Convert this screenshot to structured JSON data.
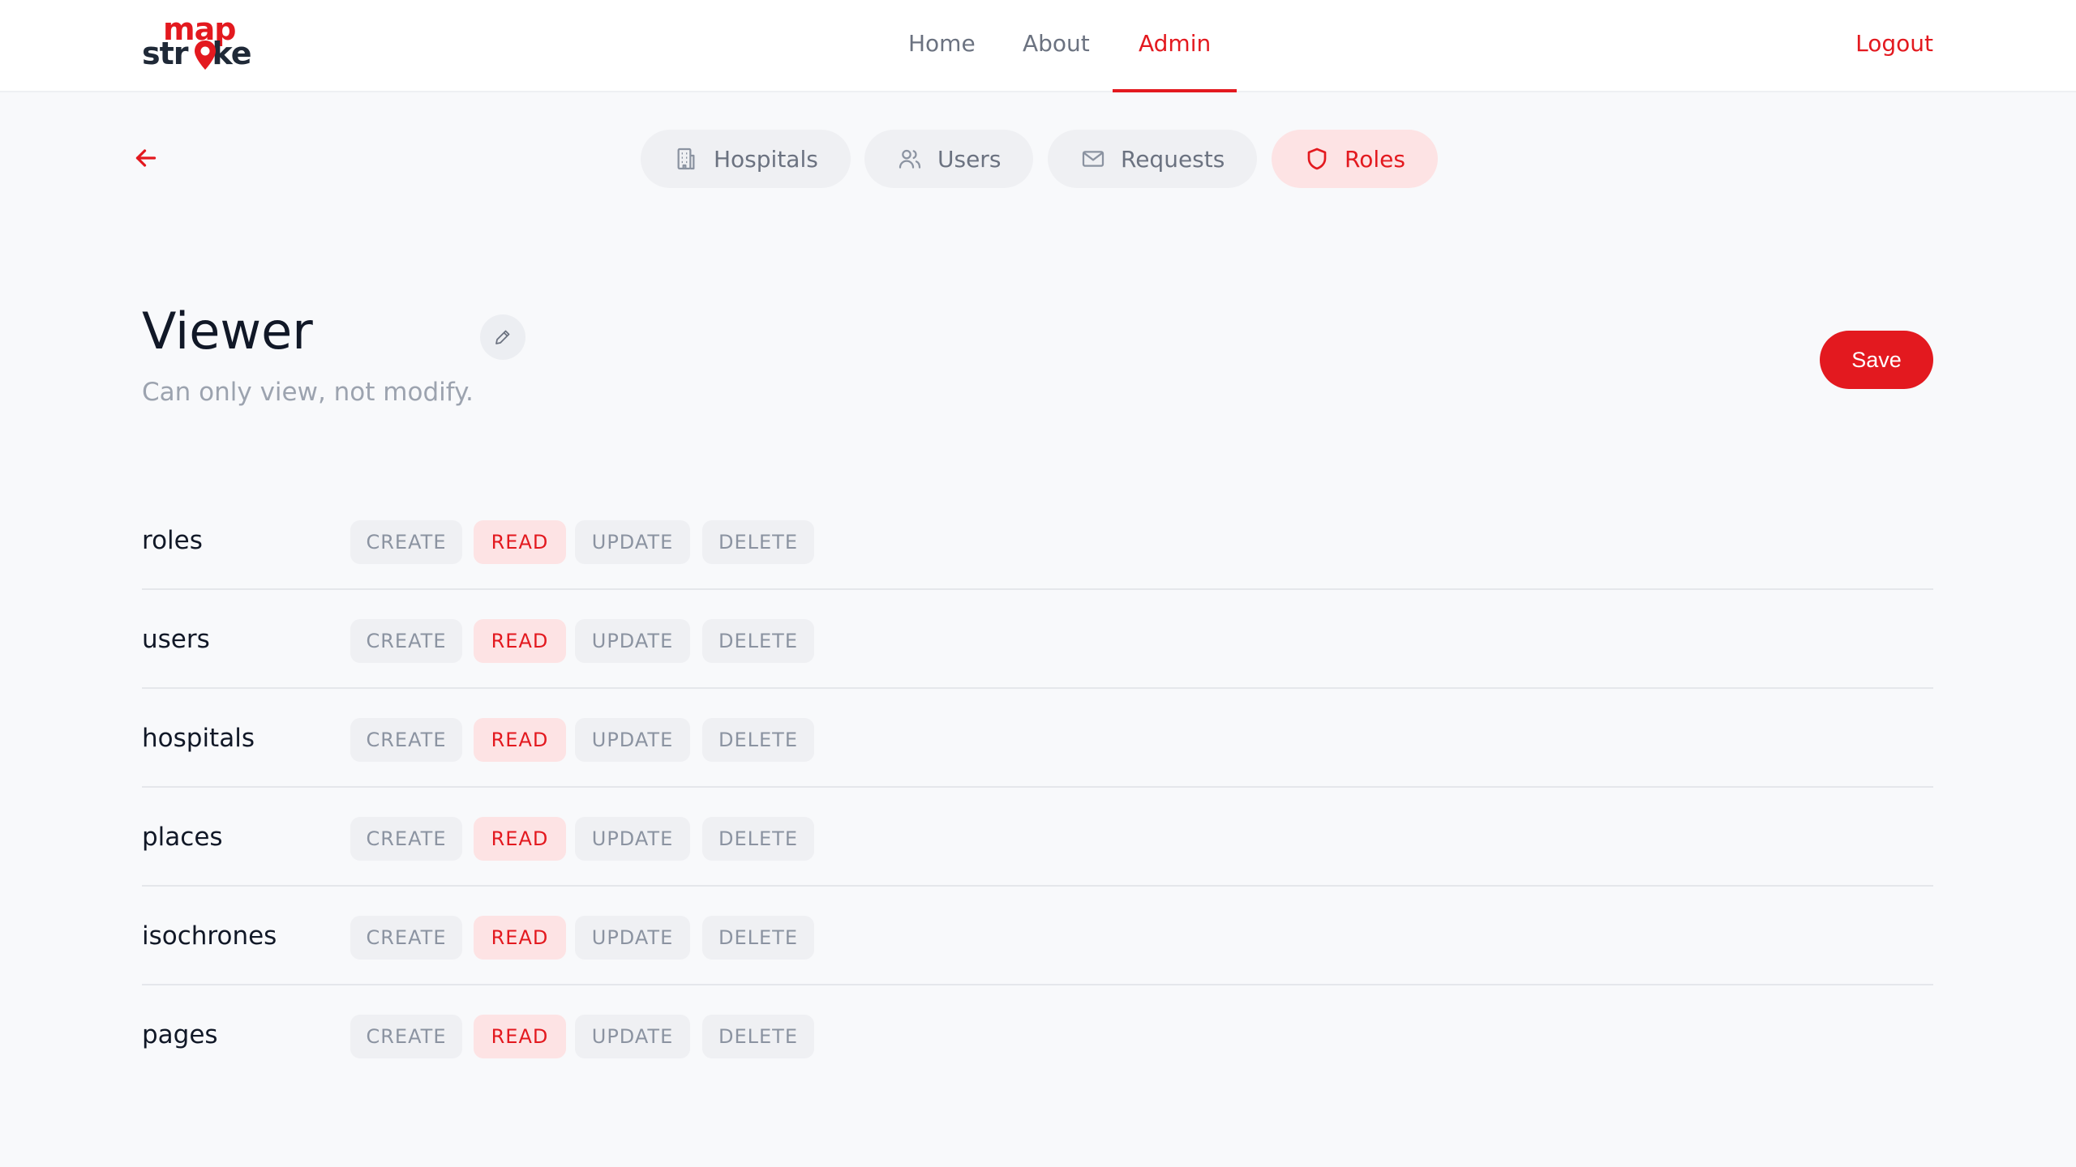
{
  "header": {
    "logo": {
      "top": "map",
      "bottom_left": "str",
      "bottom_right": "ke"
    },
    "nav": [
      {
        "label": "Home"
      },
      {
        "label": "About"
      },
      {
        "label": "Admin",
        "active": true
      }
    ],
    "logout_label": "Logout"
  },
  "subnav": {
    "back_icon": "arrow-left-icon",
    "tabs": [
      {
        "label": "Hospitals",
        "icon": "building-icon"
      },
      {
        "label": "Users",
        "icon": "users-icon"
      },
      {
        "label": "Requests",
        "icon": "mail-icon"
      },
      {
        "label": "Roles",
        "icon": "shield-icon",
        "active": true
      }
    ]
  },
  "role": {
    "name": "Viewer",
    "description": "Can only view, not modify.",
    "edit_icon": "pencil-icon",
    "save_label": "Save"
  },
  "actions": [
    "CREATE",
    "READ",
    "UPDATE",
    "DELETE"
  ],
  "permissions": [
    {
      "resource": "roles",
      "granted": [
        "READ"
      ]
    },
    {
      "resource": "users",
      "granted": [
        "READ"
      ]
    },
    {
      "resource": "hospitals",
      "granted": [
        "READ"
      ]
    },
    {
      "resource": "places",
      "granted": [
        "READ"
      ]
    },
    {
      "resource": "isochrones",
      "granted": [
        "READ"
      ]
    },
    {
      "resource": "pages",
      "granted": [
        "READ"
      ]
    }
  ],
  "colors": {
    "accent": "#e3191f",
    "accent_soft": "#fde3e4",
    "muted_bg": "#eff0f3",
    "muted_text": "#8b93a1",
    "page_bg": "#f8f9fb"
  }
}
